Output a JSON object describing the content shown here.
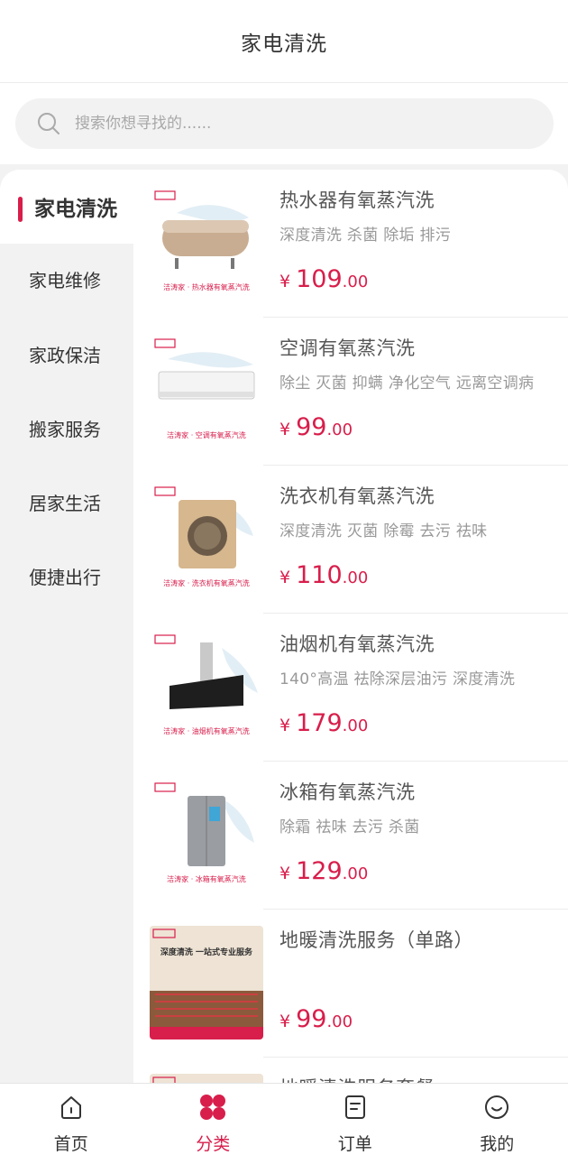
{
  "header": {
    "title": "家电清洗"
  },
  "search": {
    "placeholder": "搜索你想寻找的......"
  },
  "sidebar": {
    "items": [
      {
        "label": "家电清洗",
        "active": true
      },
      {
        "label": "家电维修"
      },
      {
        "label": "家政保洁"
      },
      {
        "label": "搬家服务"
      },
      {
        "label": "居家生活"
      },
      {
        "label": "便捷出行"
      }
    ]
  },
  "products": [
    {
      "name": "热水器有氧蒸汽洗",
      "desc": "深度清洗 杀菌 除垢 排污",
      "currency": "¥",
      "price_int": "109",
      "price_dec": ".00",
      "thumb_caption": "洁涛家 · 热水器有氧蒸汽洗"
    },
    {
      "name": "空调有氧蒸汽洗",
      "desc": "除尘 灭菌 抑螨 净化空气 远离空调病",
      "currency": "¥",
      "price_int": "99",
      "price_dec": ".00",
      "thumb_caption": "洁涛家 · 空调有氧蒸汽洗"
    },
    {
      "name": "洗衣机有氧蒸汽洗",
      "desc": "深度清洗 灭菌 除霉 去污 祛味",
      "currency": "¥",
      "price_int": "110",
      "price_dec": ".00",
      "thumb_caption": "洁涛家 · 洗衣机有氧蒸汽洗"
    },
    {
      "name": "油烟机有氧蒸汽洗",
      "desc": "140°高温 祛除深层油污 深度清洗",
      "currency": "¥",
      "price_int": "179",
      "price_dec": ".00",
      "thumb_caption": "洁涛家 · 油烟机有氧蒸汽洗"
    },
    {
      "name": "冰箱有氧蒸汽洗",
      "desc": "除霜 祛味 去污 杀菌",
      "currency": "¥",
      "price_int": "129",
      "price_dec": ".00",
      "thumb_caption": "洁涛家 · 冰箱有氧蒸汽洗"
    },
    {
      "name": "地暖清洗服务（单路）",
      "desc": "",
      "currency": "¥",
      "price_int": "99",
      "price_dec": ".00",
      "thumb_caption": "深度清洗  一站式专业服务"
    },
    {
      "name": "地暖清洗服务套餐",
      "desc": "",
      "currency": "",
      "price_int": "",
      "price_dec": "",
      "thumb_caption": ""
    }
  ],
  "tabbar": {
    "items": [
      {
        "label": "首页",
        "icon": "home-icon"
      },
      {
        "label": "分类",
        "icon": "category-icon",
        "active": true
      },
      {
        "label": "订单",
        "icon": "order-icon"
      },
      {
        "label": "我的",
        "icon": "profile-icon"
      }
    ]
  },
  "colors": {
    "accent": "#d81e4b",
    "background": "#f2f2f2",
    "text": "#333333",
    "muted": "#999999"
  }
}
